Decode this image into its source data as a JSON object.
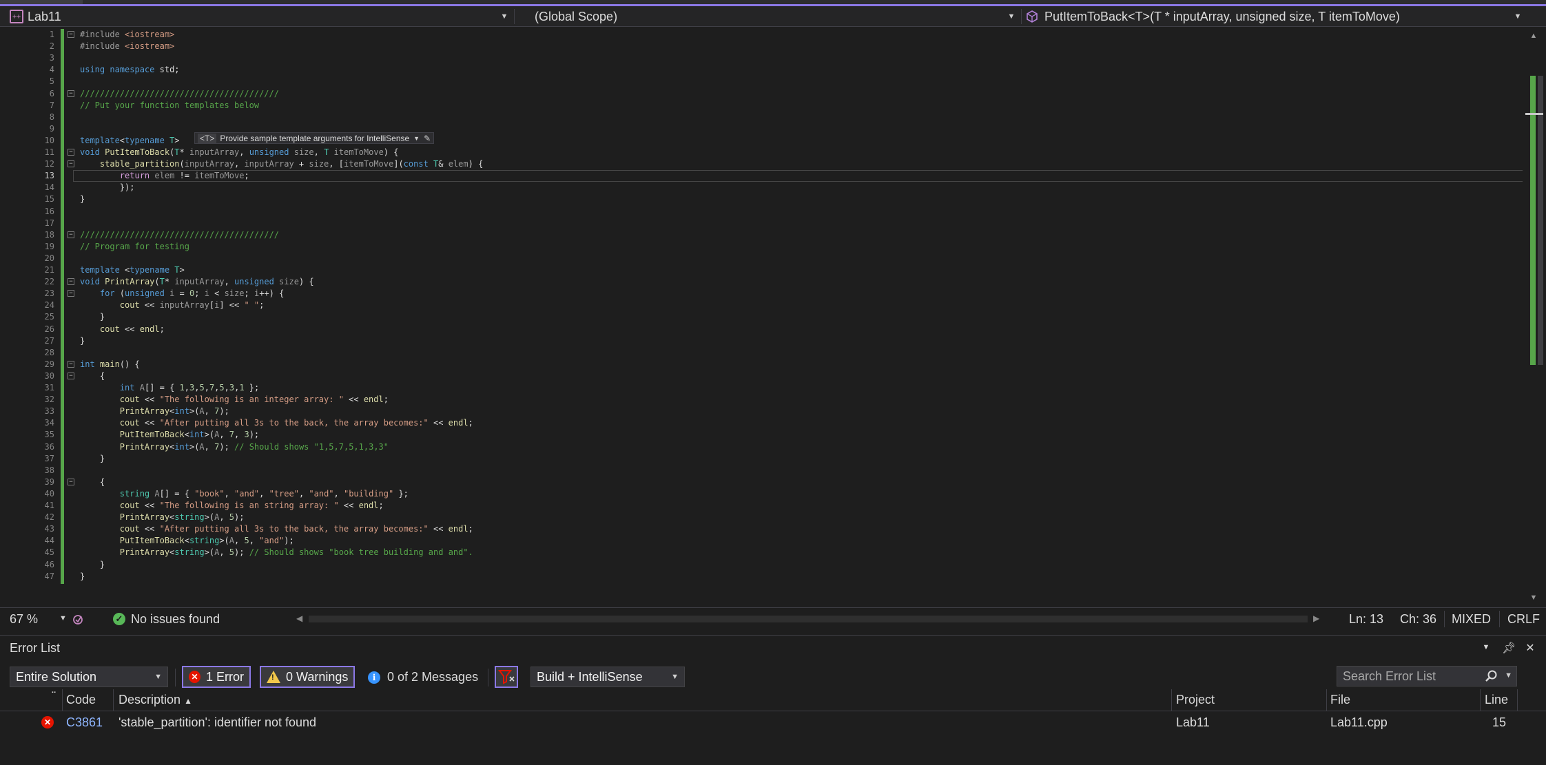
{
  "nav": {
    "project": "Lab11",
    "scope": "(Global Scope)",
    "member": "PutItemToBack<T>(T * inputArray, unsigned size, T itemToMove)"
  },
  "editor": {
    "active_line": 13,
    "hint_tag": "<T>",
    "hint_text": "Provide sample template arguments for IntelliSense",
    "lines": [
      "#include <iostream>",
      "#include <iostream>",
      "",
      "using namespace std;",
      "",
      "////////////////////////////////////////",
      "// Put your function templates below",
      "",
      "",
      "template<typename T>",
      "void PutItemToBack(T* inputArray, unsigned size, T itemToMove) {",
      "    stable_partition(inputArray, inputArray + size, [itemToMove](const T& elem) {",
      "        return elem != itemToMove;",
      "        });",
      "}",
      "",
      "",
      "////////////////////////////////////////",
      "// Program for testing",
      "",
      "template <typename T>",
      "void PrintArray(T* inputArray, unsigned size) {",
      "    for (unsigned i = 0; i < size; i++) {",
      "        cout << inputArray[i] << \" \";",
      "    }",
      "    cout << endl;",
      "}",
      "",
      "int main() {",
      "    {",
      "        int A[] = { 1,3,5,7,5,3,1 };",
      "        cout << \"The following is an integer array: \" << endl;",
      "        PrintArray<int>(A, 7);",
      "        cout << \"After putting all 3s to the back, the array becomes:\" << endl;",
      "        PutItemToBack<int>(A, 7, 3);",
      "        PrintArray<int>(A, 7); // Should shows \"1,5,7,5,1,3,3\"",
      "    }",
      "",
      "    {",
      "        string A[] = { \"book\", \"and\", \"tree\", \"and\", \"building\" };",
      "        cout << \"The following is an string array: \" << endl;",
      "        PrintArray<string>(A, 5);",
      "        cout << \"After putting all 3s to the back, the array becomes:\" << endl;",
      "        PutItemToBack<string>(A, 5, \"and\");",
      "        PrintArray<string>(A, 5); // Should shows \"book tree building and and\".",
      "    }",
      "}"
    ]
  },
  "status": {
    "zoom": "67 %",
    "issues": "No issues found",
    "ln": "Ln: 13",
    "ch": "Ch: 36",
    "mixed": "MIXED",
    "eol": "CRLF"
  },
  "errorlist": {
    "title": "Error List",
    "scope": "Entire Solution",
    "errors": "1 Error",
    "warnings": "0 Warnings",
    "messages": "0 of 2 Messages",
    "build_filter": "Build + IntelliSense",
    "search_placeholder": "Search Error List",
    "columns": {
      "code": "Code",
      "description": "Description",
      "project": "Project",
      "file": "File",
      "line": "Line"
    },
    "rows": [
      {
        "code": "C3861",
        "description": "'stable_partition': identifier not found",
        "project": "Lab11",
        "file": "Lab11.cpp",
        "line": "15"
      }
    ]
  },
  "colors": {
    "accent": "#8b78e6",
    "change_bar": "#57a64a",
    "error": "#e51400",
    "warning": "#f2c84b",
    "info": "#3794ff"
  }
}
